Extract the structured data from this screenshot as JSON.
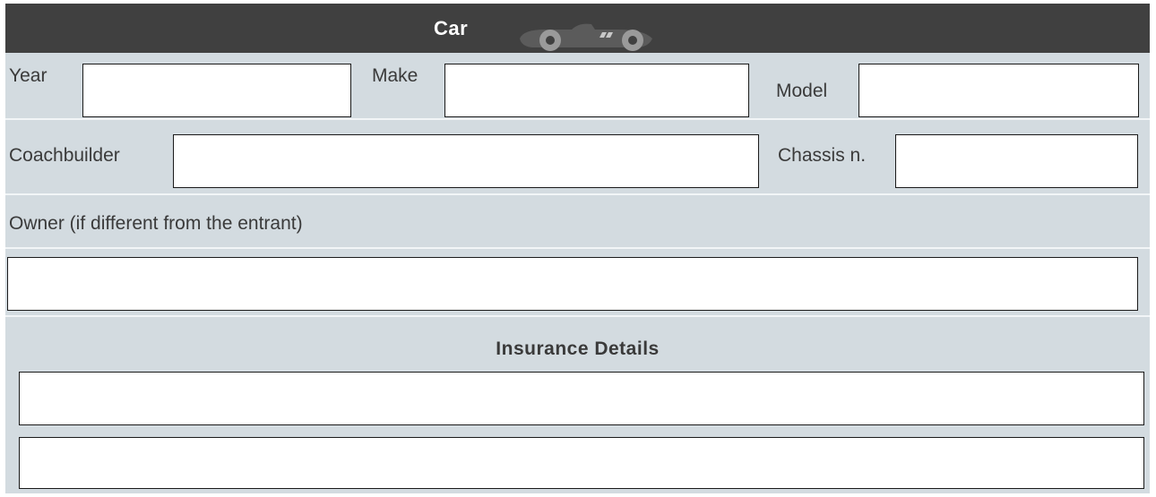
{
  "header": {
    "title": "Car",
    "icon": "race-car-icon"
  },
  "fields": {
    "year_label": "Year",
    "make_label": "Make",
    "model_label": "Model",
    "coachbuilder_label": "Coachbuilder",
    "chassis_label": "Chassis n.",
    "owner_label": "Owner (if different from the entrant)"
  },
  "values": {
    "year": "",
    "make": "",
    "model": "",
    "coachbuilder": "",
    "chassis": "",
    "owner": "",
    "insurance_1": "",
    "insurance_2": ""
  },
  "insurance": {
    "title": "Insurance Details"
  },
  "colors": {
    "header_bg": "#404040",
    "form_bg": "#d3dbe0",
    "field_bg": "#ffffff",
    "field_border": "#1a1a1a"
  }
}
